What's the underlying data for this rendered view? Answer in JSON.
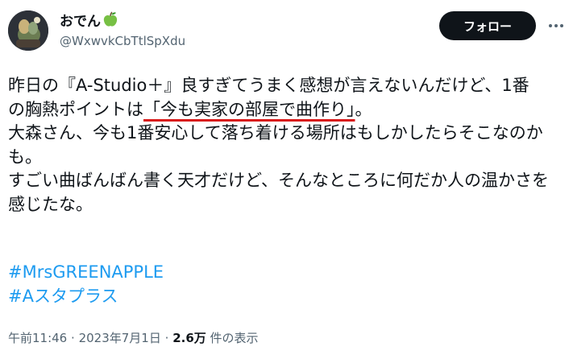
{
  "author": {
    "display_name": "おでん",
    "handle": "@WxwvkCbTtlSpXdu",
    "badge_icon": "green-apple-icon"
  },
  "actions": {
    "follow_label": "フォロー",
    "more_label": "···"
  },
  "post": {
    "line1": "昨日の『A-Studio＋』良すぎてうまく感想が言えないんだけど、1番",
    "line2_prefix": "の胸熱ポイントは",
    "line2_highlight": "「今も実家の部屋で曲作り」",
    "line2_suffix": "。",
    "paragraph2": "大森さん、今も1番安心して落ち着ける場所はもしかしたらそこなのかも。",
    "paragraph3": "すごい曲ばんばん書く天才だけど、そんなところに何だか人の温かさを感じたな。",
    "hashtags": [
      "#MrsGREENAPPLE",
      "#Aスタプラス"
    ]
  },
  "meta": {
    "time": "午前11:46",
    "separator": "·",
    "date": "2023年7月1日",
    "views_count": "2.6万",
    "views_label": "件の表示"
  },
  "colors": {
    "accent": "#1d9bf0",
    "text": "#0f1419",
    "secondary": "#536471",
    "highlight_underline": "#d91a1a"
  }
}
